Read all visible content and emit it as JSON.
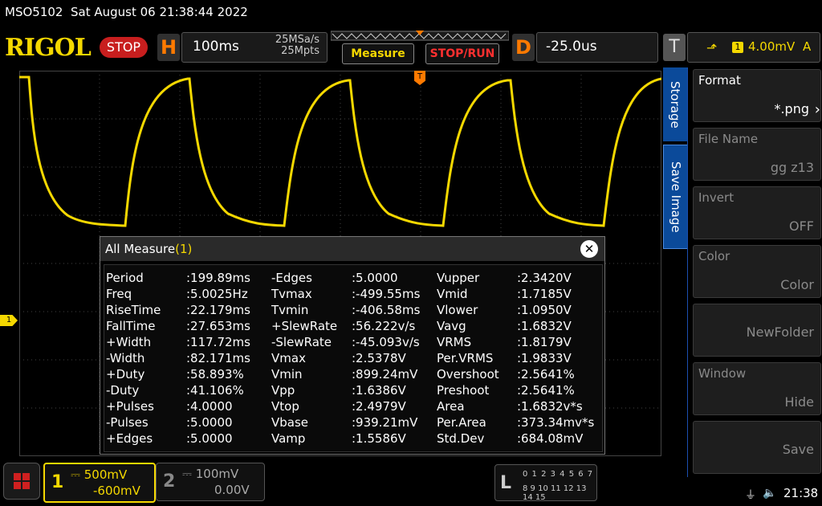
{
  "status": {
    "model": "MSO5102",
    "datetime": "Sat August 06 21:38:44 2022"
  },
  "brand": {
    "logo": "RIGOL",
    "run_state": "STOP"
  },
  "horizontal": {
    "letter": "H",
    "timebase": "100ms",
    "sample_rate": "25MSa/s",
    "memory_depth": "25Mpts"
  },
  "buttons": {
    "measure": "Measure",
    "stop_run": "STOP/RUN"
  },
  "delay": {
    "letter": "D",
    "value": "-25.0us"
  },
  "trigger": {
    "letter": "T",
    "edge_icon": "rising-edge-icon",
    "edge_glyph": "⬏",
    "channel": "1",
    "level": "4.00mV",
    "mode": "A",
    "marker": "T"
  },
  "channel_marker": "1",
  "measure_panel": {
    "title": "All Measure",
    "count": "(1)",
    "close_glyph": "✕",
    "columns": [
      [
        {
          "name": "Period",
          "value": ":199.89ms"
        },
        {
          "name": "Freq",
          "value": ":5.0025Hz"
        },
        {
          "name": "RiseTime",
          "value": ":22.179ms"
        },
        {
          "name": "FallTime",
          "value": ":27.653ms"
        },
        {
          "name": "+Width",
          "value": ":117.72ms"
        },
        {
          "name": "-Width",
          "value": ":82.171ms"
        },
        {
          "name": "+Duty",
          "value": ":58.893%"
        },
        {
          "name": "-Duty",
          "value": ":41.106%"
        },
        {
          "name": "+Pulses",
          "value": ":4.0000"
        },
        {
          "name": "-Pulses",
          "value": ":5.0000"
        },
        {
          "name": "+Edges",
          "value": ":5.0000"
        }
      ],
      [
        {
          "name": "-Edges",
          "value": ":5.0000"
        },
        {
          "name": "Tvmax",
          "value": ":-499.55ms"
        },
        {
          "name": "Tvmin",
          "value": ":-406.58ms"
        },
        {
          "name": "+SlewRate",
          "value": ":56.222v/s"
        },
        {
          "name": "-SlewRate",
          "value": ":-45.093v/s"
        },
        {
          "name": "Vmax",
          "value": ":2.5378V"
        },
        {
          "name": "Vmin",
          "value": ":899.24mV"
        },
        {
          "name": "Vpp",
          "value": ":1.6386V"
        },
        {
          "name": "Vtop",
          "value": ":2.4979V"
        },
        {
          "name": "Vbase",
          "value": ":939.21mV"
        },
        {
          "name": "Vamp",
          "value": ":1.5586V"
        }
      ],
      [
        {
          "name": "Vupper",
          "value": ":2.3420V"
        },
        {
          "name": "Vmid",
          "value": ":1.7185V"
        },
        {
          "name": "Vlower",
          "value": ":1.0950V"
        },
        {
          "name": "Vavg",
          "value": ":1.6832V"
        },
        {
          "name": "VRMS",
          "value": ":1.8179V"
        },
        {
          "name": "Per.VRMS",
          "value": ":1.9833V"
        },
        {
          "name": "Overshoot",
          "value": ":2.5641%"
        },
        {
          "name": "Preshoot",
          "value": ":2.5641%"
        },
        {
          "name": "Area",
          "value": ":1.6832v*s"
        },
        {
          "name": "Per.Area",
          "value": ":373.34mv*s"
        },
        {
          "name": "Std.Dev",
          "value": ":684.08mV"
        }
      ]
    ]
  },
  "menu": {
    "tabs": [
      "Storage",
      "Save Image"
    ],
    "items": [
      {
        "label": "Format",
        "value": "*.png",
        "enabled": true
      },
      {
        "label": "File Name",
        "value": "gg z13",
        "enabled": false
      },
      {
        "label": "Invert",
        "value": "OFF",
        "enabled": false
      },
      {
        "label": "Color",
        "value": "Color",
        "enabled": false
      },
      {
        "label": "",
        "value": "NewFolder",
        "enabled": false
      },
      {
        "label": "Window",
        "value": "Hide",
        "enabled": false
      },
      {
        "label": "",
        "value": "Save",
        "enabled": false
      }
    ]
  },
  "channels": {
    "ch1": {
      "num": "1",
      "scale": "500mV",
      "offset": "-600mV",
      "coupling_icon": "dc-coupling-icon",
      "coupling_glyph": "⎓"
    },
    "ch2": {
      "num": "2",
      "scale": "100mV",
      "offset": "0.00V",
      "coupling_icon": "dc-coupling-icon",
      "coupling_glyph": "⎓"
    }
  },
  "logic": {
    "letter": "L",
    "row1": "0 1 2 3  4 5 6 7",
    "row2": "8 9 10 11 12 13 14 15"
  },
  "system": {
    "clock": "21:38",
    "usb_glyph": "⏚",
    "speaker_glyph": "🔈"
  },
  "colors": {
    "ch1": "#f5d800",
    "accent": "#ff7a00",
    "menu_blue": "#0b4a9a",
    "stop": "#c81e1e"
  }
}
